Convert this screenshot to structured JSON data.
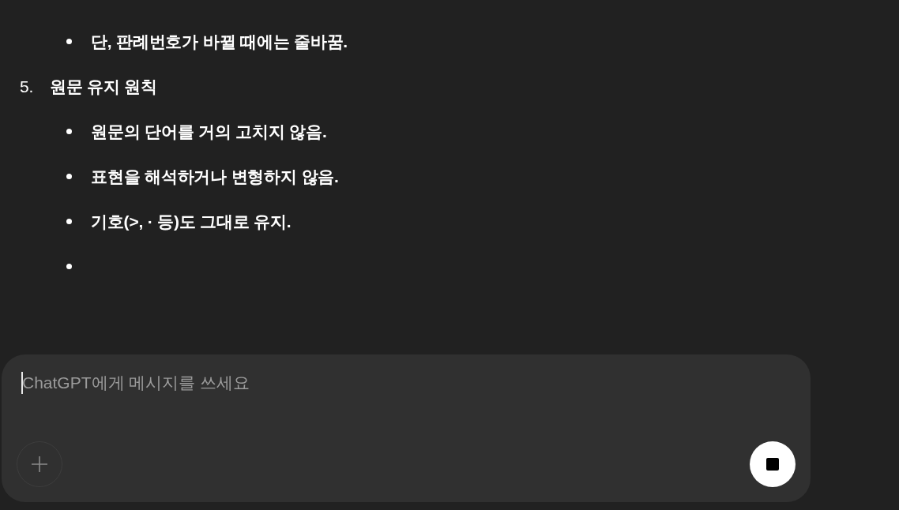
{
  "message": {
    "items": [
      {
        "kind": "bullet",
        "text": "단, 판례번호가 바뀔 때에는 줄바꿈."
      },
      {
        "kind": "numbered",
        "number": "5.",
        "text": "원문 유지 원칙"
      },
      {
        "kind": "bullet",
        "text": "원문의 단어를 거의 고치지 않음."
      },
      {
        "kind": "bullet",
        "text": "표현을 해석하거나 변형하지 않음."
      },
      {
        "kind": "bullet",
        "text": "기호(>, · 등)도 그대로 유지."
      },
      {
        "kind": "bullet-empty"
      }
    ]
  },
  "composer": {
    "placeholder": "ChatGPT에게 메시지를 쓰세요",
    "action_button": {
      "kind": "stop"
    }
  }
}
